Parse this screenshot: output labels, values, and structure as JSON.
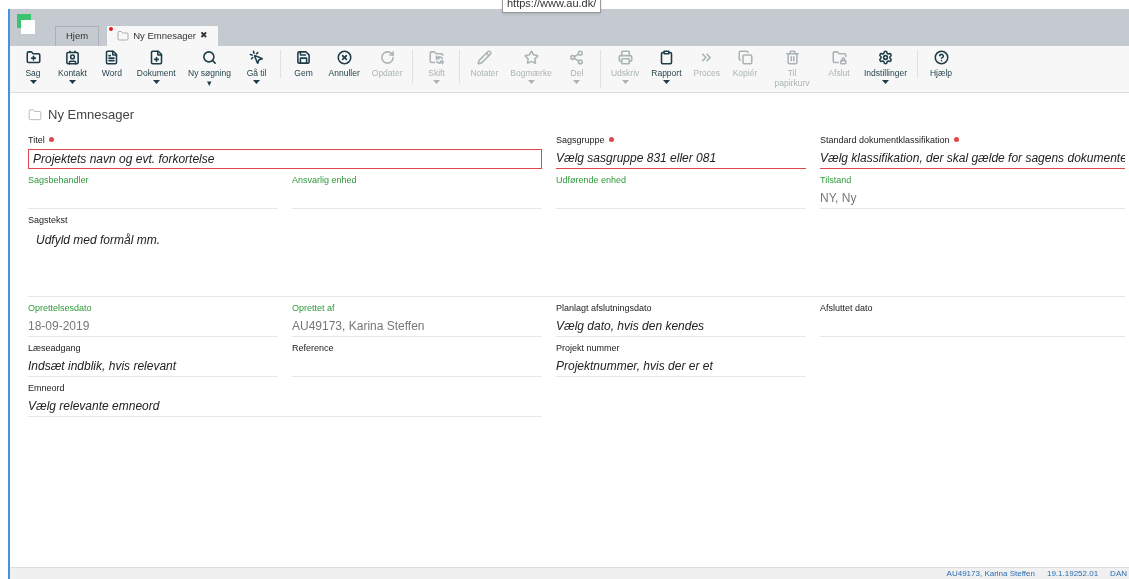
{
  "tooltip": "https://www.au.dk/",
  "tabs": [
    {
      "label": "Hjem",
      "selected": false,
      "modified": false
    },
    {
      "label": "Ny Emnesager",
      "selected": true,
      "modified": true,
      "close": "✖"
    }
  ],
  "toolbar": [
    {
      "buttons": [
        {
          "label": "Sag",
          "disabled": false,
          "menu": true
        },
        {
          "label": "Kontakt",
          "disabled": false,
          "menu": true
        },
        {
          "label": "Word",
          "disabled": false,
          "menu": false
        },
        {
          "label": "Dokument",
          "disabled": false,
          "menu": true
        },
        {
          "label": "Ny søgning ▾",
          "disabled": false,
          "menu": false
        },
        {
          "label": "Gå til",
          "disabled": false,
          "menu": true
        }
      ]
    },
    {
      "buttons": [
        {
          "label": "Gem",
          "disabled": false,
          "menu": false
        },
        {
          "label": "Annuller",
          "disabled": false,
          "menu": false
        },
        {
          "label": "Opdater",
          "disabled": true,
          "menu": false
        }
      ]
    },
    {
      "buttons": [
        {
          "label": "Skift",
          "disabled": true,
          "menu": true
        }
      ]
    },
    {
      "buttons": [
        {
          "label": "Notater",
          "disabled": true,
          "menu": false
        },
        {
          "label": "Bogmærke",
          "disabled": true,
          "menu": true
        },
        {
          "label": "Del",
          "disabled": true,
          "menu": true
        }
      ]
    },
    {
      "buttons": [
        {
          "label": "Udskriv",
          "disabled": true,
          "menu": true
        },
        {
          "label": "Rapport",
          "disabled": false,
          "menu": true
        },
        {
          "label": "Proces",
          "disabled": true,
          "menu": false
        },
        {
          "label": "Kopiér",
          "disabled": true,
          "menu": false
        },
        {
          "label": "Til papirkurv",
          "disabled": true,
          "menu": false
        },
        {
          "label": "Afslut",
          "disabled": true,
          "menu": false
        },
        {
          "label": "Indstillinger",
          "disabled": false,
          "menu": true
        }
      ]
    },
    {
      "buttons": [
        {
          "label": "Hjælp",
          "disabled": false,
          "menu": false
        }
      ]
    }
  ],
  "page_title": "Ny Emnesager",
  "rows": [
    {
      "kind": "normal",
      "fields": [
        {
          "label": "Titel",
          "required": true,
          "auto": false,
          "kind": "boxed",
          "placeholder": "Projektets navn og evt. forkortelse"
        },
        {
          "label": "Sagsgruppe",
          "required": true,
          "auto": false,
          "kind": "underline",
          "placeholder": "Vælg sasgruppe 831 eller 081"
        },
        {
          "label": "Standard dokumentklassifikation",
          "required": true,
          "auto": false,
          "kind": "underline",
          "placeholder": "Vælg klassifikation, der skal gælde for sagens dokumente"
        }
      ]
    },
    {
      "kind": "normal",
      "fields": [
        {
          "label": "Sagsbehandler",
          "required": false,
          "auto": true,
          "kind": "underline"
        },
        {
          "label": "Ansvarlig enhed",
          "required": false,
          "auto": true,
          "kind": "underline"
        },
        {
          "label": "Udførende enhed",
          "required": false,
          "auto": true,
          "kind": "underline"
        },
        {
          "label": "Tilstand",
          "required": false,
          "auto": true,
          "kind": "underline",
          "value": "NY, Ny"
        }
      ]
    },
    {
      "kind": "tall",
      "fields": [
        {
          "label": "Sagstekst",
          "required": false,
          "auto": false,
          "kind": "underline",
          "placeholder": "Udfyld med formål mm."
        }
      ]
    },
    {
      "kind": "normal",
      "fields": [
        {
          "label": "Oprettelsesdato",
          "required": false,
          "auto": true,
          "kind": "underline",
          "value": "18-09-2019"
        },
        {
          "label": "Oprettet af",
          "required": false,
          "auto": true,
          "kind": "underline",
          "value": "AU49173, Karina Steffen"
        },
        {
          "label": "Planlagt afslutningsdato",
          "required": false,
          "auto": false,
          "kind": "underline",
          "placeholder": "Vælg dato, hvis den kendes"
        },
        {
          "label": "Afsluttet dato",
          "required": false,
          "auto": false,
          "kind": "underline"
        }
      ]
    },
    {
      "kind": "normal",
      "fields": [
        {
          "label": "Læseadgang",
          "required": false,
          "auto": false,
          "kind": "underline",
          "placeholder": "Indsæt indblik, hvis relevant"
        },
        {
          "label": "Reference",
          "required": false,
          "auto": false,
          "kind": "underline"
        },
        {
          "label": "Projekt nummer",
          "required": false,
          "auto": false,
          "kind": "underline",
          "placeholder": "Projektnummer, hvis der er et"
        }
      ]
    },
    {
      "kind": "normal",
      "fields": [
        {
          "label": "Emneord",
          "required": false,
          "auto": false,
          "kind": "underline",
          "placeholder": "Vælg relevante emneord"
        }
      ]
    }
  ],
  "status_bar": [
    "AU49173, Karina Steffen",
    "19.1.19252.01",
    "DAN"
  ]
}
